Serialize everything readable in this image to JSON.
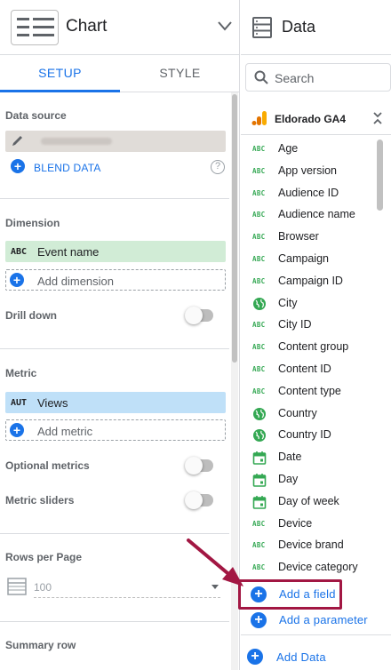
{
  "chart_panel": {
    "title": "Chart",
    "tabs": [
      "SETUP",
      "STYLE"
    ],
    "active_tab": "SETUP",
    "data_source": {
      "label": "Data source",
      "blend_label": "BLEND DATA"
    },
    "dimension": {
      "label": "Dimension",
      "field_type": "ABC",
      "field_name": "Event name",
      "add_label": "Add dimension",
      "drill_down_label": "Drill down",
      "drill_down_on": false
    },
    "metric": {
      "label": "Metric",
      "field_type": "AUT",
      "field_name": "Views",
      "add_label": "Add metric",
      "optional_label": "Optional metrics",
      "optional_on": false,
      "sliders_label": "Metric sliders",
      "sliders_on": false
    },
    "rows_per_page": {
      "label": "Rows per Page",
      "value": "100"
    },
    "summary_row_label": "Summary row"
  },
  "data_panel": {
    "title": "Data",
    "search_placeholder": "Search",
    "source_name": "Eldorado GA4",
    "fields": [
      {
        "type": "text",
        "tag": "ABC",
        "name": "Age"
      },
      {
        "type": "text",
        "tag": "ABC",
        "name": "App version"
      },
      {
        "type": "text",
        "tag": "ABC",
        "name": "Audience ID"
      },
      {
        "type": "text",
        "tag": "ABC",
        "name": "Audience name"
      },
      {
        "type": "text",
        "tag": "ABC",
        "name": "Browser"
      },
      {
        "type": "text",
        "tag": "ABC",
        "name": "Campaign"
      },
      {
        "type": "text",
        "tag": "ABC",
        "name": "Campaign ID"
      },
      {
        "type": "geo",
        "tag": "",
        "name": "City"
      },
      {
        "type": "text",
        "tag": "ABC",
        "name": "City ID"
      },
      {
        "type": "text",
        "tag": "ABC",
        "name": "Content group"
      },
      {
        "type": "text",
        "tag": "ABC",
        "name": "Content ID"
      },
      {
        "type": "text",
        "tag": "ABC",
        "name": "Content type"
      },
      {
        "type": "geo",
        "tag": "",
        "name": "Country"
      },
      {
        "type": "geo",
        "tag": "",
        "name": "Country ID"
      },
      {
        "type": "date",
        "tag": "",
        "name": "Date"
      },
      {
        "type": "date",
        "tag": "",
        "name": "Day"
      },
      {
        "type": "date",
        "tag": "",
        "name": "Day of week"
      },
      {
        "type": "text",
        "tag": "ABC",
        "name": "Device"
      },
      {
        "type": "text",
        "tag": "ABC",
        "name": "Device brand"
      },
      {
        "type": "text",
        "tag": "ABC",
        "name": "Device category"
      }
    ],
    "add_field_label": "Add a field",
    "add_parameter_label": "Add a parameter",
    "add_data_label": "Add Data"
  },
  "colors": {
    "accent": "#1a73e8",
    "dimension_chip": "#d1ecd6",
    "metric_chip": "#bfe0f8",
    "field_icon_green": "#34a853",
    "highlight": "#a21743"
  }
}
